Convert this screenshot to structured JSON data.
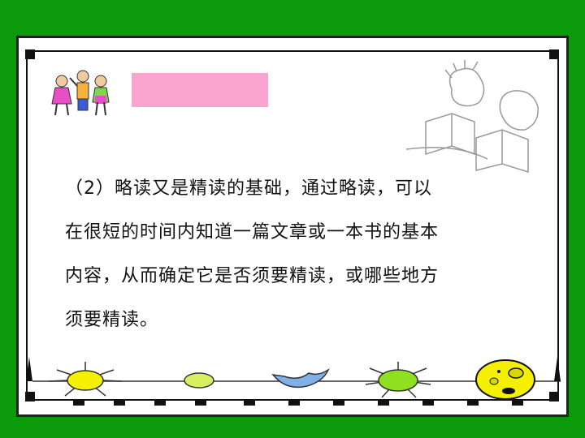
{
  "slide": {
    "paragraph_lines": [
      "（2）略读又是精读的基础，通过略读，可以",
      "在很短的时间内知道一篇文章或一本书的基本",
      "内容，从而确定它是否须要精读，或哪些地方",
      "须要精读。"
    ]
  },
  "colors": {
    "background": "#0a9a0a",
    "label_box": "#f9a3cf",
    "sun_yellow": "#f5f000",
    "light_green": "#d8f060",
    "moon_blue": "#7fb0e8",
    "bright_green": "#8fe020"
  },
  "icons": [
    "children-clipart-icon",
    "reading-kids-clipart-icon",
    "sun-icon",
    "oval-icon",
    "moon-icon",
    "green-sun-icon",
    "smiley-sun-icon"
  ]
}
